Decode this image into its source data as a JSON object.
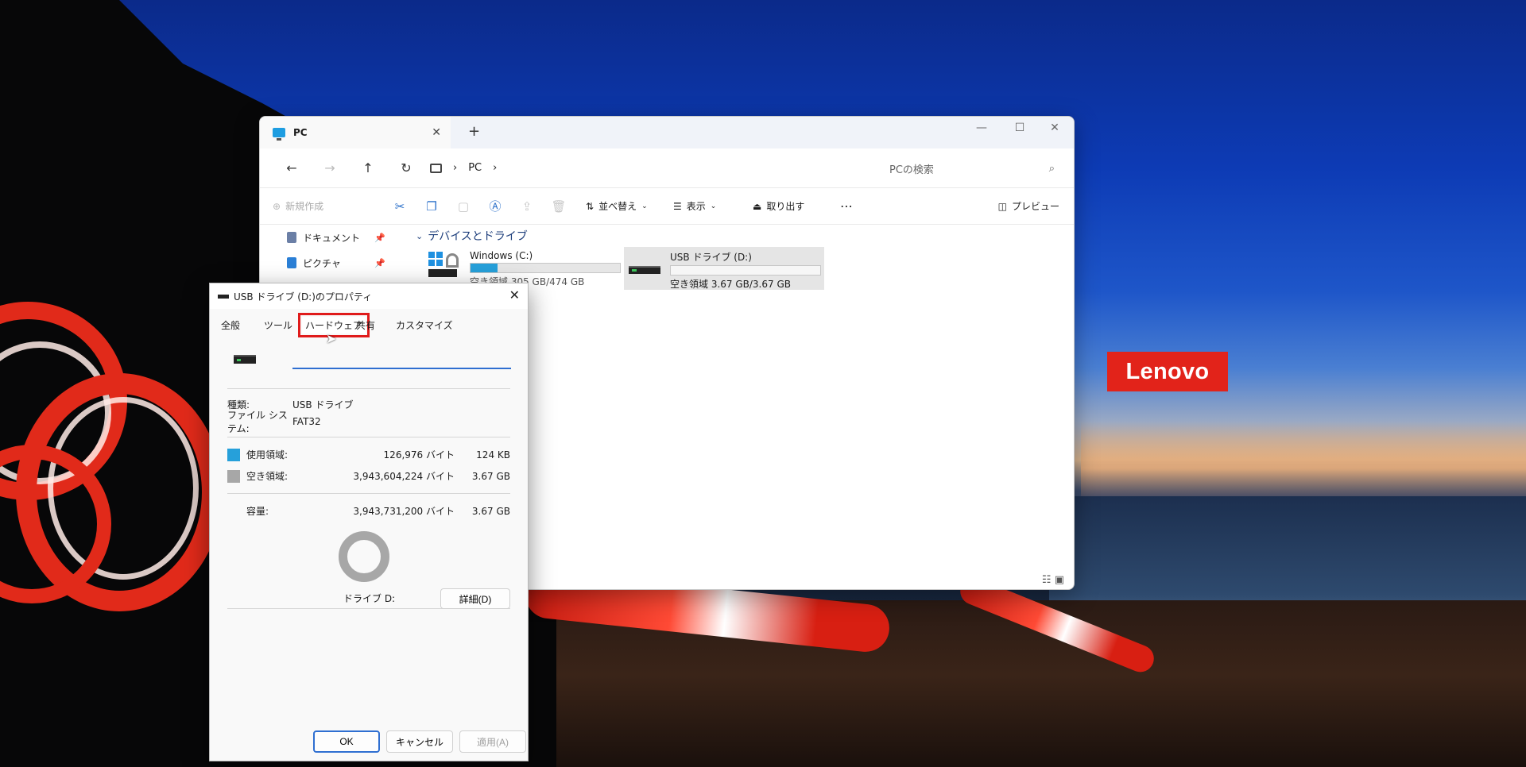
{
  "brand": {
    "logo_text": "Lenovo",
    "color": "#e2231a"
  },
  "explorer": {
    "tab_title": "PC",
    "new_tab": "+",
    "address_path": "PC",
    "search_placeholder": "PCの検索",
    "toolbar": {
      "new": "新規作成",
      "sort": "並べ替え",
      "view": "表示",
      "eject": "取り出す",
      "more": "⋯",
      "preview": "プレビュー"
    },
    "sidebar": [
      {
        "label": "ドキュメント",
        "color": "#6b7fa6"
      },
      {
        "label": "ピクチャ",
        "color": "#2a7fd6"
      }
    ],
    "group_header": "デバイスとドライブ",
    "drives": [
      {
        "label": "Windows (C:)",
        "space": "空き領域 305 GB/474 GB",
        "used_fraction": 0.18
      },
      {
        "label": "USB ドライブ (D:)",
        "space": "空き領域 3.67 GB/3.67 GB",
        "used_fraction": 0.0
      }
    ]
  },
  "dialog": {
    "title": "USB ドライブ (D:)のプロパティ",
    "tabs": [
      "全般",
      "ツール",
      "ハードウェア",
      "共有",
      "カスタマイズ"
    ],
    "highlighted_tab": "ハードウェア",
    "name_value": "",
    "type_label": "種類:",
    "type_value": "USB ドライブ",
    "fs_label": "ファイル システム:",
    "fs_value": "FAT32",
    "used_label": "使用領域:",
    "used_bytes": "126,976 バイト",
    "used_size": "124 KB",
    "free_label": "空き領域:",
    "free_bytes": "3,943,604,224 バイト",
    "free_size": "3.67 GB",
    "capacity_label": "容量:",
    "capacity_bytes": "3,943,731,200 バイト",
    "capacity_size": "3.67 GB",
    "drive_caption": "ドライブ D:",
    "detail_button": "詳細(D)",
    "ok": "OK",
    "cancel": "キャンセル",
    "apply": "適用(A)",
    "used_color": "#26a0da",
    "free_color": "#a7a7a7"
  }
}
